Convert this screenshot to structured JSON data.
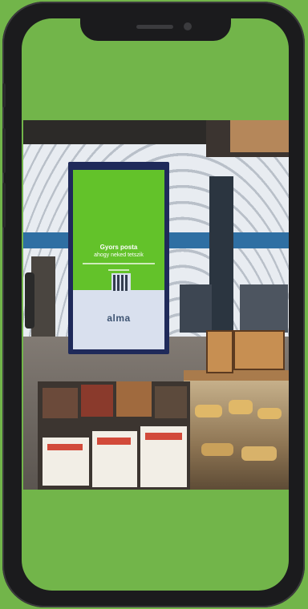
{
  "device": {
    "frame_color": "#1b1b1d",
    "background_color": "#72b54a",
    "icons": [
      "speaker-icon",
      "front-camera-icon"
    ]
  },
  "photo": {
    "billboard": {
      "line1": "Gyors posta",
      "line2": "ahogy neked tetszik",
      "logo": "alma"
    }
  }
}
